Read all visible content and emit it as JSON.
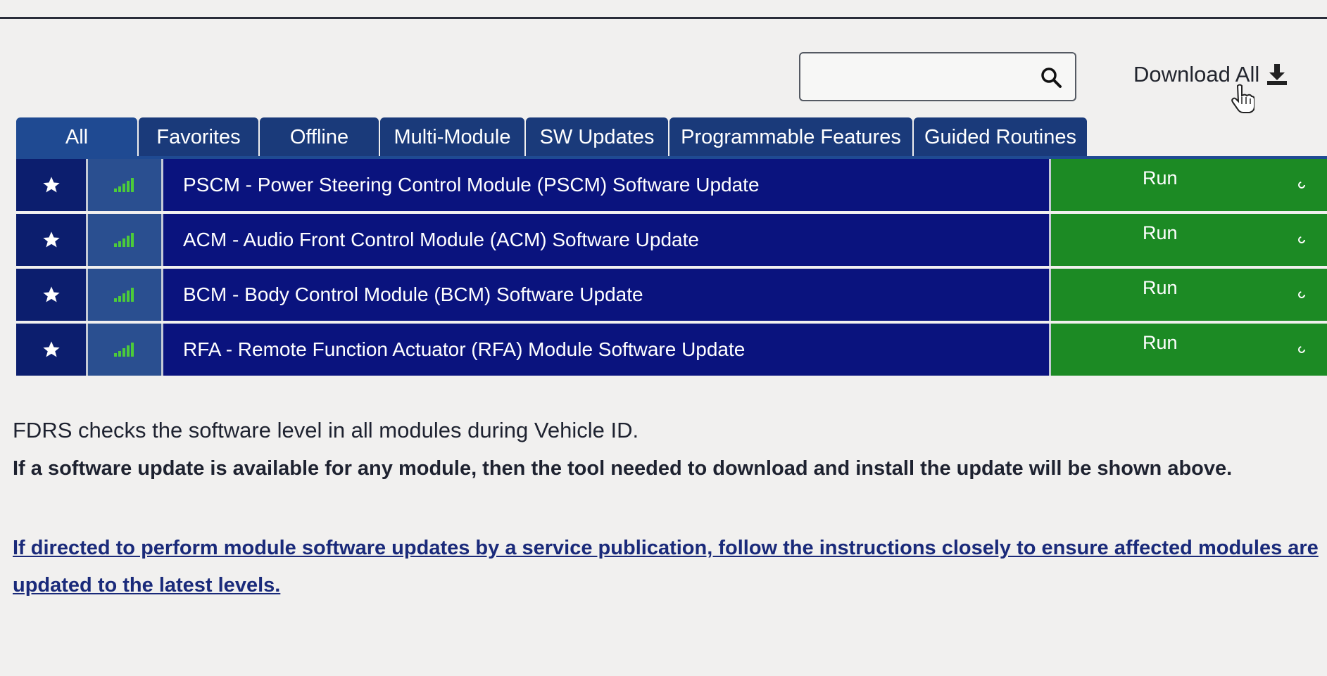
{
  "search": {
    "value": "",
    "placeholder": ""
  },
  "download_all": {
    "label": "Download All"
  },
  "tabs": [
    {
      "label": "All",
      "active": true
    },
    {
      "label": "Favorites"
    },
    {
      "label": "Offline"
    },
    {
      "label": "Multi-Module"
    },
    {
      "label": "SW Updates"
    },
    {
      "label": "Programmable Features"
    },
    {
      "label": "Guided Routines"
    }
  ],
  "rows": [
    {
      "title": "PSCM - Power Steering Control Module (PSCM) Software Update",
      "action": "Run"
    },
    {
      "title": "ACM - Audio Front Control Module (ACM) Software Update",
      "action": "Run"
    },
    {
      "title": "BCM - Body Control Module (BCM) Software Update",
      "action": "Run"
    },
    {
      "title": "RFA - Remote Function Actuator (RFA) Module Software Update",
      "action": "Run"
    }
  ],
  "info": {
    "line1": "FDRS checks the software level in all modules during Vehicle ID.",
    "line2": "If a software update is available for any module, then the tool needed to download and install the update will be shown above.",
    "link": "If directed to perform module software updates by a service publication, follow the instructions closely to ensure affected modules are updated to the latest levels."
  },
  "colors": {
    "tab_bg": "#1a3a7a",
    "row_title_bg": "#0a137e",
    "row_fav_bg": "#0c1e6e",
    "row_signal_bg": "#2a4f90",
    "run_bg": "#1c8a24",
    "signal_green": "#4ccb3a"
  },
  "icons": {
    "search": "search-icon",
    "download": "download-icon",
    "favorite": "star-icon",
    "signal": "signal-strength-icon",
    "cursor": "hand-cursor-icon",
    "spinner": "spinner-icon"
  }
}
